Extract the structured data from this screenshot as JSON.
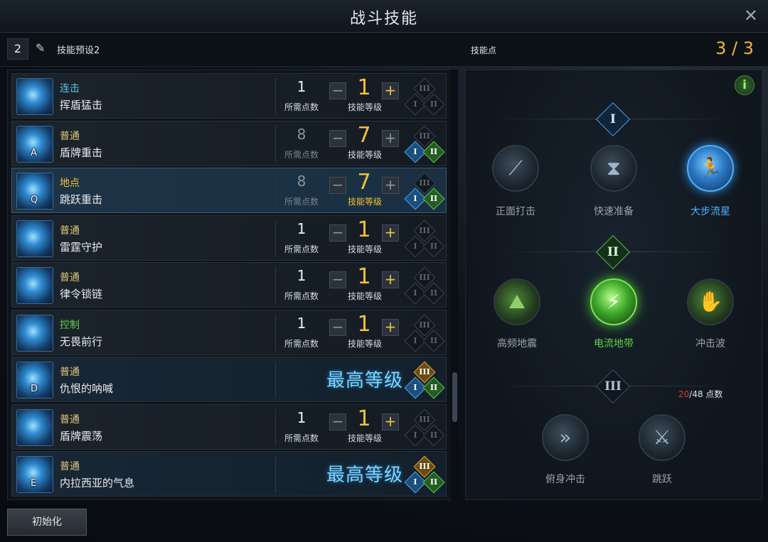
{
  "window": {
    "title": "战斗技能",
    "close_icon": "close-icon"
  },
  "preset": {
    "number": "2",
    "icon": "edit-icon",
    "name": "技能预设2",
    "points_label": "技能点",
    "points_value": "3 / 3"
  },
  "labels": {
    "need_points": "所需点数",
    "skill_level": "技能等级",
    "max_level": "最高等级",
    "minus": "−",
    "plus": "+"
  },
  "tier_marks": {
    "one": "I",
    "two": "II",
    "three": "III"
  },
  "skills": [
    {
      "type": "连击",
      "name": "挥盾猛击",
      "key": "",
      "need": "1",
      "level": "1"
    },
    {
      "type": "普通",
      "name": "盾牌重击",
      "key": "A",
      "need": "8",
      "level": "7"
    },
    {
      "type": "地点",
      "name": "跳跃重击",
      "key": "Q",
      "need": "8",
      "level": "7"
    },
    {
      "type": "普通",
      "name": "雷霆守护",
      "key": "",
      "need": "1",
      "level": "1"
    },
    {
      "type": "普通",
      "name": "律令锁链",
      "key": "",
      "need": "1",
      "level": "1"
    },
    {
      "type": "控制",
      "name": "无畏前行",
      "key": "",
      "need": "1",
      "level": "1"
    },
    {
      "type": "普通",
      "name": "仇恨的呐喊",
      "key": "D",
      "need": "",
      "level": ""
    },
    {
      "type": "普通",
      "name": "盾牌震荡",
      "key": "",
      "need": "1",
      "level": "1"
    },
    {
      "type": "普通",
      "name": "内拉西亚的气息",
      "key": "E",
      "need": "",
      "level": ""
    }
  ],
  "reset_button": "初始化",
  "tree": {
    "tier1": {
      "mark": "I",
      "nodes": [
        {
          "label": "正面打击",
          "icon": "sword-strike-icon"
        },
        {
          "label": "快速准备",
          "icon": "hourglass-icon"
        },
        {
          "label": "大步流星",
          "icon": "running-man-icon",
          "selected": true
        }
      ]
    },
    "tier2": {
      "mark": "II",
      "nodes": [
        {
          "label": "高频地震",
          "icon": "mountain-icon"
        },
        {
          "label": "电流地带",
          "icon": "lightning-icon",
          "selected": true
        },
        {
          "label": "冲击波",
          "icon": "shockwave-hand-icon"
        }
      ]
    },
    "tier3": {
      "mark": "III",
      "points_current": "20",
      "points_rest": "/48 点数",
      "nodes": [
        {
          "label": "俯身冲击",
          "icon": "chevron-dash-icon"
        },
        {
          "label": "跳跃",
          "icon": "crossed-swords-icon"
        }
      ]
    }
  },
  "info_icon": "i"
}
